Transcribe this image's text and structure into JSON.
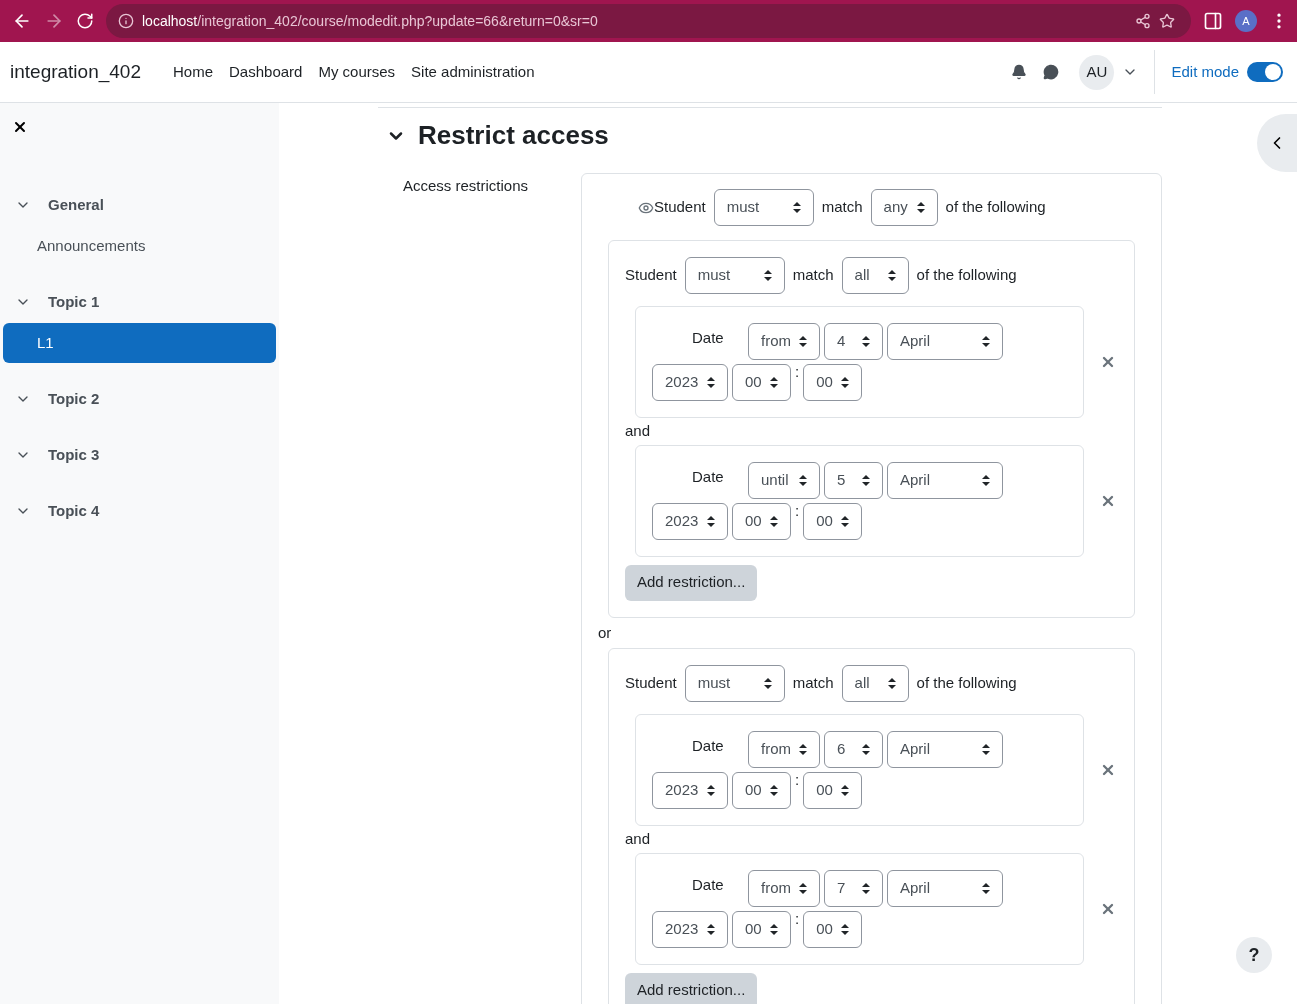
{
  "browser": {
    "url_host": "localhost",
    "url_path": "/integration_402/course/modedit.php?update=66&return=0&sr=0",
    "profile": "A"
  },
  "navbar": {
    "site": "integration_402",
    "links": [
      "Home",
      "Dashboard",
      "My courses",
      "Site administration"
    ],
    "avatar": "AU",
    "edit_mode": {
      "label": "Edit mode",
      "on": true
    }
  },
  "sidebar": {
    "items": [
      {
        "label": "General",
        "kind": "section",
        "expanded": true,
        "selected": false
      },
      {
        "label": "Announcements",
        "kind": "activity",
        "selected": false
      },
      {
        "label": "Topic 1",
        "kind": "section",
        "expanded": true,
        "selected": false
      },
      {
        "label": "L1",
        "kind": "activity",
        "selected": true
      },
      {
        "label": "Topic 2",
        "kind": "section",
        "expanded": true,
        "selected": false
      },
      {
        "label": "Topic 3",
        "kind": "section",
        "expanded": true,
        "selected": false
      },
      {
        "label": "Topic 4",
        "kind": "section",
        "expanded": true,
        "selected": false
      }
    ]
  },
  "section": {
    "title": "Restrict access",
    "expanded": true,
    "field_label": "Access restrictions",
    "root": {
      "label": "Student",
      "must": "must",
      "match_word": "match",
      "match": "any",
      "suffix": "of the following"
    },
    "groups": [
      {
        "header": {
          "label": "Student",
          "must": "must",
          "match_word": "match",
          "match": "all",
          "suffix": "of the following"
        },
        "conditions": [
          {
            "label": "Date",
            "direction": "from",
            "day": "4",
            "month": "April",
            "year": "2023",
            "hour": "00",
            "time_separator": ":",
            "minute": "00"
          },
          {
            "joiner": "and",
            "label": "Date",
            "direction": "until",
            "day": "5",
            "month": "April",
            "year": "2023",
            "hour": "00",
            "time_separator": ":",
            "minute": "00"
          }
        ],
        "add_button": "Add restriction..."
      },
      {
        "joiner": "or",
        "header": {
          "label": "Student",
          "must": "must",
          "match_word": "match",
          "match": "all",
          "suffix": "of the following"
        },
        "conditions": [
          {
            "label": "Date",
            "direction": "from",
            "day": "6",
            "month": "April",
            "year": "2023",
            "hour": "00",
            "time_separator": ":",
            "minute": "00"
          },
          {
            "joiner": "and",
            "label": "Date",
            "direction": "from",
            "day": "7",
            "month": "April",
            "year": "2023",
            "hour": "00",
            "time_separator": ":",
            "minute": "00"
          }
        ],
        "add_button": "Add restriction..."
      }
    ]
  },
  "help_button": "?"
}
